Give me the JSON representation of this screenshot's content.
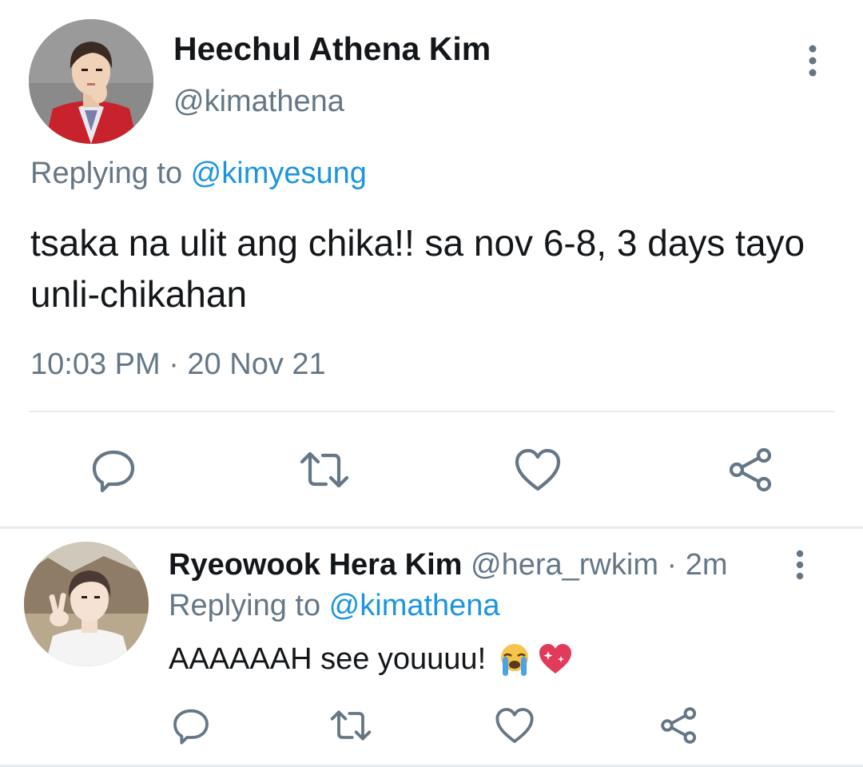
{
  "main_tweet": {
    "display_name": "Heechul Athena Kim",
    "handle": "@kimathena",
    "replying_prefix": "Replying to ",
    "replying_to": "@kimyesung",
    "text": "tsaka na ulit ang chika!! sa nov 6-8, 3 days tayo unli-chikahan",
    "timestamp": "10:03 PM · 20 Nov 21",
    "icons": {
      "avatar": "avatar-photo",
      "more": "more-vertical-icon",
      "reply": "reply-bubble-icon",
      "retweet": "retweet-icon",
      "like": "heart-icon",
      "share": "share-icon"
    }
  },
  "reply_tweet": {
    "display_name": "Ryeowook Hera Kim",
    "handle": "@hera_rwkim",
    "separator": " · ",
    "time_ago": "2m",
    "replying_prefix": "Replying to ",
    "replying_to": "@kimathena",
    "text": "AAAAAAH see youuuu!",
    "emojis": [
      "loudly-crying-face",
      "sparkling-heart"
    ],
    "icons": {
      "avatar": "avatar-photo",
      "more": "more-vertical-icon",
      "reply": "reply-bubble-icon",
      "retweet": "retweet-icon",
      "like": "heart-icon",
      "share": "share-icon"
    }
  },
  "colors": {
    "text_primary": "#14171a",
    "text_secondary": "#657786",
    "link": "#1b95e0",
    "divider": "#e6ecf0"
  }
}
